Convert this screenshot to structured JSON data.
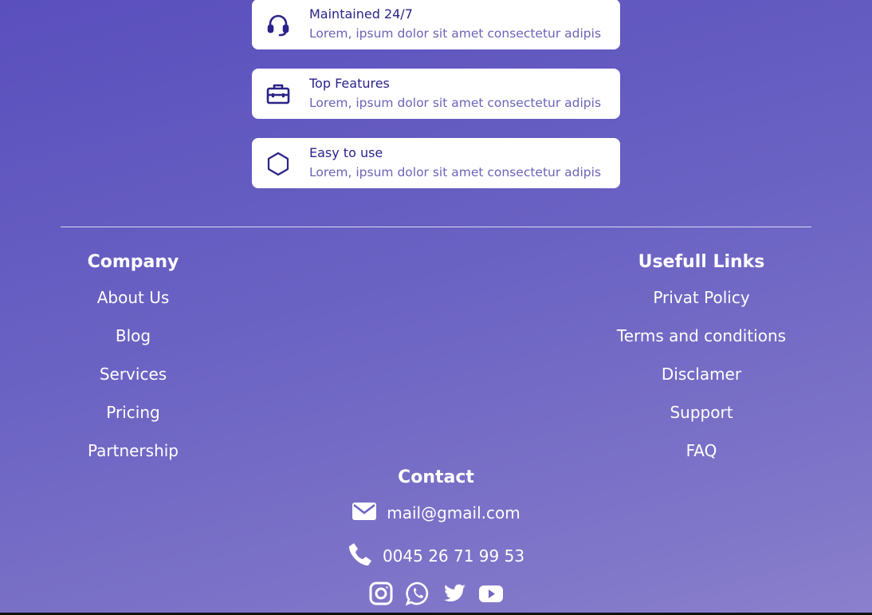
{
  "features": [
    {
      "icon": "headset-icon",
      "title": "Maintained 24/7",
      "description": "Lorem, ipsum dolor sit amet consectetur adipis"
    },
    {
      "icon": "toolbox-icon",
      "title": "Top Features",
      "description": "Lorem, ipsum dolor sit amet consectetur adipis"
    },
    {
      "icon": "hexagon-icon",
      "title": "Easy to use",
      "description": "Lorem, ipsum dolor sit amet consectetur adipis"
    }
  ],
  "footer": {
    "company": {
      "heading": "Company",
      "links": [
        "About Us",
        "Blog",
        "Services",
        "Pricing",
        "Partnership"
      ]
    },
    "useful_links": {
      "heading": "Usefull Links",
      "links": [
        "Privat Policy",
        "Terms and conditions",
        "Disclamer",
        "Support",
        "FAQ"
      ]
    },
    "contact": {
      "heading": "Contact",
      "email": "mail@gmail.com",
      "phone": "0045 26 71 99 53"
    },
    "socials": [
      "instagram-icon",
      "whatsapp-icon",
      "twitter-icon",
      "youtube-icon"
    ]
  },
  "colors": {
    "accent": "#2a238a",
    "description": "#6a63b8",
    "background_top": "#5a4fbd",
    "background_bottom": "#8a80cc"
  }
}
